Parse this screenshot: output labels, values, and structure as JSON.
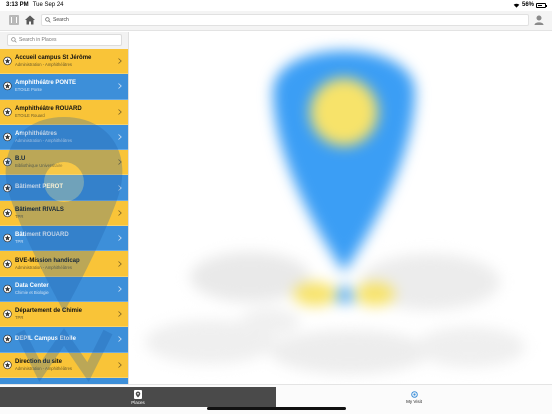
{
  "status_bar": {
    "time": "3:13 PM",
    "date": "Tue Sep 24",
    "battery": "56%"
  },
  "top_bar": {
    "search_placeholder": "Search"
  },
  "sidebar": {
    "search_placeholder": "Search in Places",
    "items": [
      {
        "title": "Accueil campus St Jérôme",
        "subtitle": "Administration - Amphithéâtres",
        "color": "yellow"
      },
      {
        "title": "Amphithéâtre PONTE",
        "subtitle": "ETOILE Ponte",
        "color": "blue"
      },
      {
        "title": "Amphithéâtre ROUARD",
        "subtitle": "ETOILE Rouard",
        "color": "yellow"
      },
      {
        "title": "Amphithéâtres",
        "subtitle": "Administration - Amphithéâtres",
        "color": "blue"
      },
      {
        "title": "B.U",
        "subtitle": "Bibliothèque Universitaire",
        "color": "yellow"
      },
      {
        "title": "Bâtiment PEROT",
        "subtitle": "",
        "color": "blue"
      },
      {
        "title": "Bâtiment RIVALS",
        "subtitle": "TPR",
        "color": "yellow"
      },
      {
        "title": "Bâtiment ROUARD",
        "subtitle": "TPR",
        "color": "blue"
      },
      {
        "title": "BVE-Mission handicap",
        "subtitle": "Administration - Amphithéâtres",
        "color": "yellow"
      },
      {
        "title": "Data Center",
        "subtitle": "Chimie et Biologie",
        "color": "blue"
      },
      {
        "title": "Département de Chimie",
        "subtitle": "TPR",
        "color": "yellow"
      },
      {
        "title": "DEPIL Campus Etoile",
        "subtitle": "",
        "color": "blue"
      },
      {
        "title": "Direction du site",
        "subtitle": "Administration - Amphithéâtres",
        "color": "yellow"
      },
      {
        "title": "",
        "subtitle": "",
        "color": "blue"
      }
    ]
  },
  "tabs": {
    "places_label": "Places",
    "visit_label": "My Visit"
  },
  "colors": {
    "yellow": "#f9c438",
    "blue": "#3d8fd9",
    "tab_active": "#4a4a4a",
    "pin": "#3b9ef5",
    "pin_center": "#f7e36a"
  }
}
